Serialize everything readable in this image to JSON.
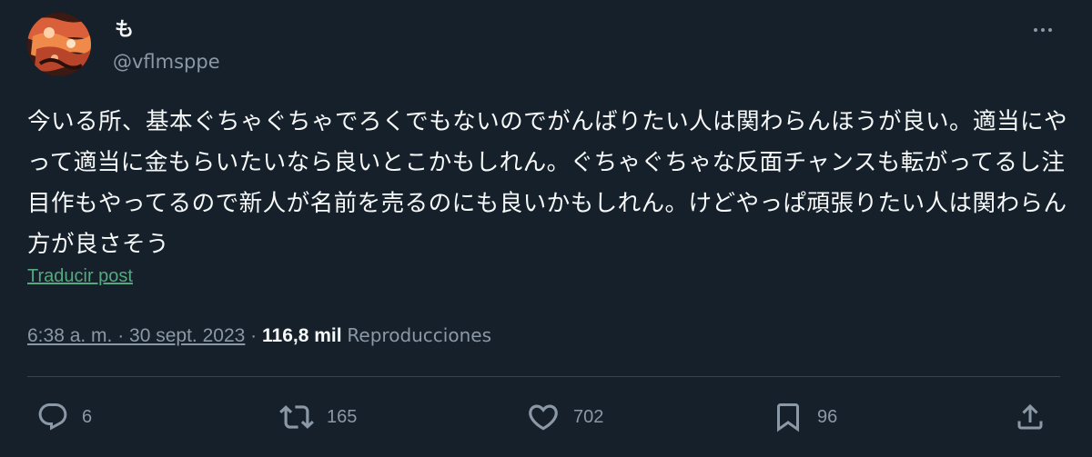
{
  "author": {
    "display_name": "も",
    "handle": "@vflmsppe"
  },
  "post": {
    "text": "今いる所、基本ぐちゃぐちゃでろくでもないのでがんばりたい人は関わらんほうが良い。適当にやって適当に金もらいたいなら良いとこかもしれん。ぐちゃぐちゃな反面チャンスも転がってるし注目作もやってるので新人が名前を売るのにも良いかもしれん。けどやっぱ頑張りたい人は関わらん方が良さそう",
    "translate_label": "Traducir post",
    "timestamp": "6:38 a. m. · 30 sept. 2023",
    "separator": " · ",
    "views_count": "116,8 mil",
    "views_label": "Reproducciones"
  },
  "actions": {
    "replies": "6",
    "reposts": "165",
    "likes": "702",
    "bookmarks": "96"
  },
  "icons": {
    "more": "more-icon",
    "reply": "reply-icon",
    "repost": "repost-icon",
    "like": "heart-icon",
    "bookmark": "bookmark-icon",
    "share": "share-icon"
  },
  "colors": {
    "background": "#15202b",
    "text": "#f7f9f9",
    "secondary": "#8b98a5",
    "translate_link": "#55a97e",
    "divider": "#38444d"
  }
}
